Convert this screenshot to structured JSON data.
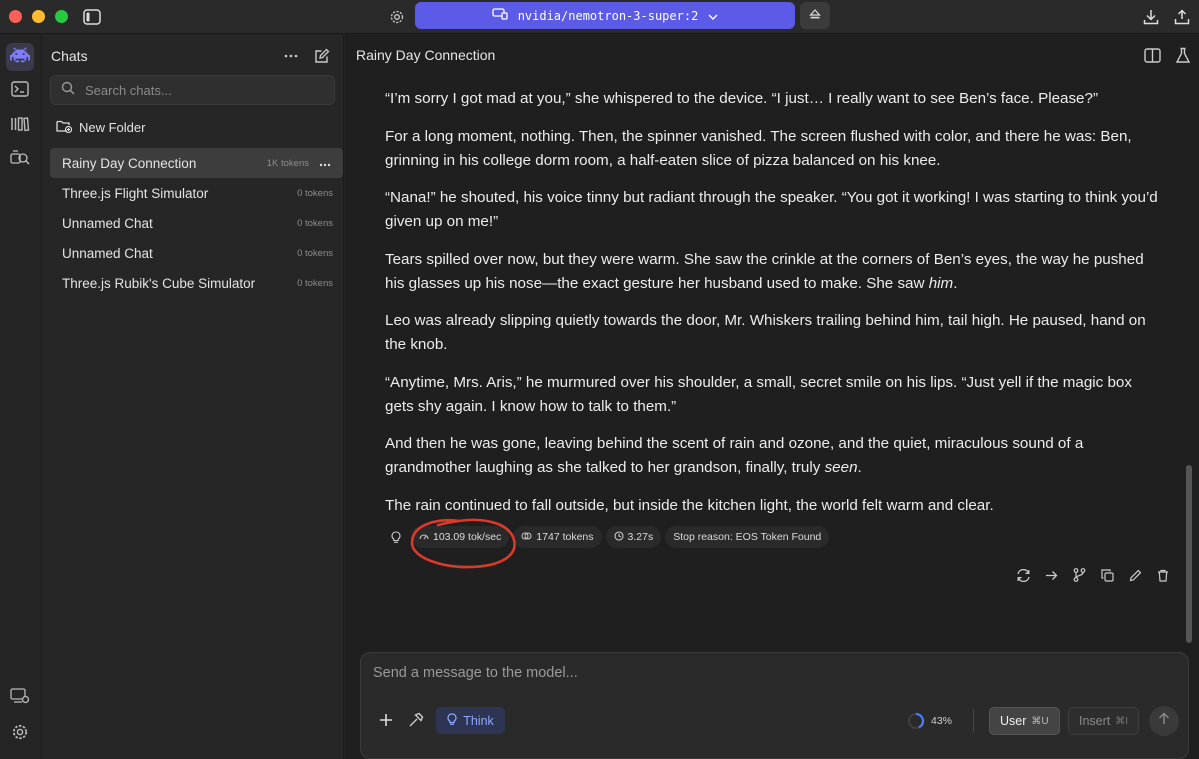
{
  "titlebar": {
    "model_name": "nvidia/nemotron-3-super:2"
  },
  "sidebar": {
    "title": "Chats",
    "search_placeholder": "Search chats...",
    "new_folder_label": "New Folder",
    "chats": [
      {
        "title": "Rainy Day Connection",
        "tokens": "1K tokens",
        "active": true
      },
      {
        "title": "Three.js Flight Simulator",
        "tokens": "0 tokens"
      },
      {
        "title": "Unnamed Chat",
        "tokens": "0 tokens"
      },
      {
        "title": "Unnamed Chat",
        "tokens": "0 tokens"
      },
      {
        "title": "Three.js Rubik's Cube Simulator",
        "tokens": "0 tokens"
      }
    ]
  },
  "main": {
    "title": "Rainy Day Connection",
    "paragraphs": [
      "“I’m sorry I got mad at you,” she whispered to the device. “I just… I really want to see Ben’s face. Please?”",
      "For a long moment, nothing. Then, the spinner vanished. The screen flushed with color, and there he was: Ben, grinning in his college dorm room, a half-eaten slice of pizza balanced on his knee.",
      "“Nana!” he shouted, his voice tinny but radiant through the speaker. “You got it working! I was starting to think you’d given up on me!”",
      "Tears spilled over now, but they were warm. She saw the crinkle at the corners of Ben’s eyes, the way he pushed his glasses up his nose—the exact gesture her husband used to make. She saw ",
      "Leo was already slipping quietly towards the door, Mr. Whiskers trailing behind him, tail high. He paused, hand on the knob.",
      "“Anytime, Mrs. Aris,” he murmured over his shoulder, a small, secret smile on his lips. “Just yell if the magic box gets shy again. I know how to talk to them.”",
      "And then he was gone, leaving behind the scent of rain and ozone, and the quiet, miraculous sound of a grandmother laughing as she talked to her grandson, finally, truly ",
      "The rain continued to fall outside, but inside the kitchen light, the world felt warm and clear."
    ],
    "emphasis": {
      "p4": "him",
      "p7": "seen"
    },
    "stats": {
      "speed": "103.09 tok/sec",
      "tokens": "1747 tokens",
      "time": "3.27s",
      "stop_reason": "Stop reason: EOS Token Found"
    }
  },
  "composer": {
    "placeholder": "Send a message to the model...",
    "think_label": "Think",
    "context_percent": "43%",
    "context_fill": 0.43,
    "user_label": "User",
    "user_shortcut": "⌘U",
    "insert_label": "Insert",
    "insert_shortcut": "⌘I"
  },
  "colors": {
    "accent": "#5b5be8",
    "think_text": "#8ea8ff",
    "annotation_red": "#d93a2a"
  }
}
